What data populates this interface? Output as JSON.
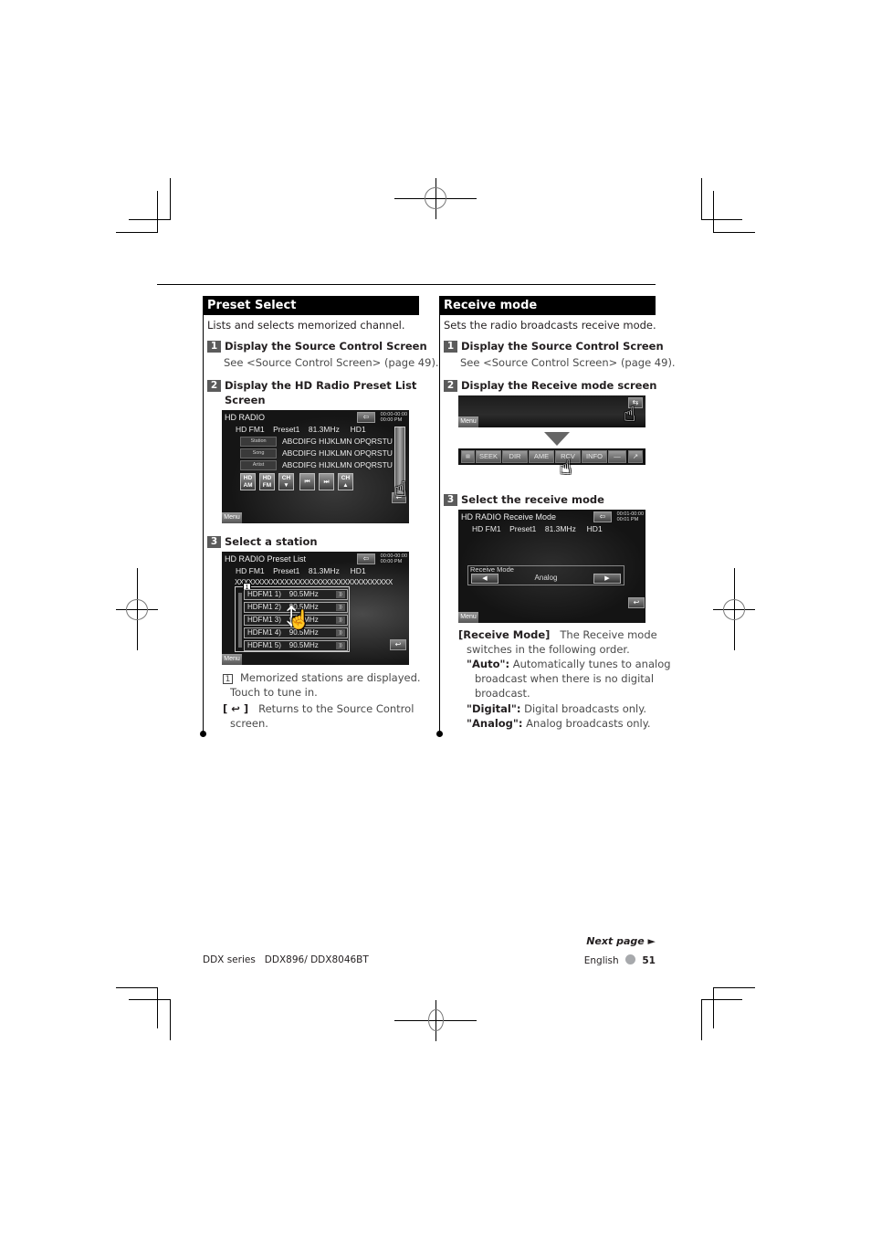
{
  "left_section": {
    "heading": "Preset Select",
    "intro": "Lists and selects memorized channel.",
    "steps": [
      {
        "num": "1",
        "title": "Display the Source Control Screen",
        "detail": "See <Source Control Screen> (page 49)."
      },
      {
        "num": "2",
        "title": "Display the HD Radio Preset List",
        "title_line2": "Screen"
      },
      {
        "num": "3",
        "title": "Select a station"
      }
    ],
    "screen1": {
      "title": "HD RADIO",
      "time_line1": "00:00-00:00",
      "time_line2": "00:00 PM",
      "info": [
        "HD FM1",
        "Preset1",
        "81.3MHz",
        "HD1"
      ],
      "rows": [
        {
          "label": "Station",
          "value": "ABCDIFG HIJKLMN OPQRSTU"
        },
        {
          "label": "Song",
          "value": "ABCDIFG HIJKLMN OPQRSTU"
        },
        {
          "label": "Artist",
          "value": "ABCDIFG HIJKLMN OPQRSTU"
        }
      ],
      "buttons": [
        {
          "line1": "HD",
          "line2": "AM"
        },
        {
          "line1": "HD",
          "line2": "FM"
        },
        {
          "line1": "CH",
          "line2": "▼"
        },
        {
          "line1": "⏮",
          "line2": ""
        },
        {
          "line1": "⏭",
          "line2": ""
        },
        {
          "line1": "CH",
          "line2": "▲"
        }
      ],
      "menu": "Menu"
    },
    "screen2": {
      "title": "HD RADIO Preset List",
      "time_line1": "00:00-00:00",
      "time_line2": "00:00 PM",
      "info": [
        "HD FM1",
        "Preset1",
        "81.3MHz",
        "HD1"
      ],
      "scroll_text": "XXXXXXXXXXXXXXXXXXXXXXXXXXXXXXXXXXX",
      "callout": "1",
      "presets": [
        {
          "name": "HDFM1  1)",
          "freq": "90.5MHz"
        },
        {
          "name": "HDFM1  2)",
          "freq": "90.5MHz"
        },
        {
          "name": "HDFM1  3)",
          "freq": "90.5MHz"
        },
        {
          "name": "HDFM1  4)",
          "freq": "90.5MHz"
        },
        {
          "name": "HDFM1  5)",
          "freq": "90.5MHz"
        }
      ],
      "menu": "Menu"
    },
    "notes": [
      {
        "marker": "1",
        "text": "Memorized stations are displayed.",
        "text2": "Touch to tune in."
      },
      {
        "marker": "[ ↩ ]",
        "text": "Returns to the Source Control",
        "text2": "screen."
      }
    ]
  },
  "right_section": {
    "heading": "Receive mode",
    "intro": "Sets the radio broadcasts receive mode.",
    "steps": [
      {
        "num": "1",
        "title": "Display the Source Control Screen",
        "detail": "See <Source Control Screen> (page 49)."
      },
      {
        "num": "2",
        "title": "Display the Receive mode screen"
      },
      {
        "num": "3",
        "title": "Select the receive mode"
      }
    ],
    "screen_top": {
      "menu": "Menu"
    },
    "function_bar": [
      "SEEK",
      "DIR",
      "AME",
      "RCV",
      "INFO",
      "—"
    ],
    "screen3": {
      "title": "HD RADIO Receive Mode",
      "time_line1": "00:01-00:00",
      "time_line2": "00:01 PM",
      "info": [
        "HD FM1",
        "Preset1",
        "81.3MHz",
        "HD1"
      ],
      "mode_label": "Receive Mode",
      "mode_value": "Analog",
      "menu": "Menu"
    },
    "desc": {
      "term": "[Receive Mode]",
      "term_text": "The Receive mode",
      "term_text2": "switches in the following order.",
      "options": [
        {
          "key": "\"Auto\":",
          "text": "Automatically tunes to analog",
          "text2": "broadcast when there is no digital",
          "text3": "broadcast."
        },
        {
          "key": "\"Digital\":",
          "text": "Digital broadcasts only."
        },
        {
          "key": "\"Analog\":",
          "text": "Analog broadcasts only."
        }
      ]
    }
  },
  "footer": {
    "next_page": "Next page ►",
    "model": "DDX series   DDX896/ DDX8046BT",
    "language": "English",
    "page_number": "51"
  }
}
